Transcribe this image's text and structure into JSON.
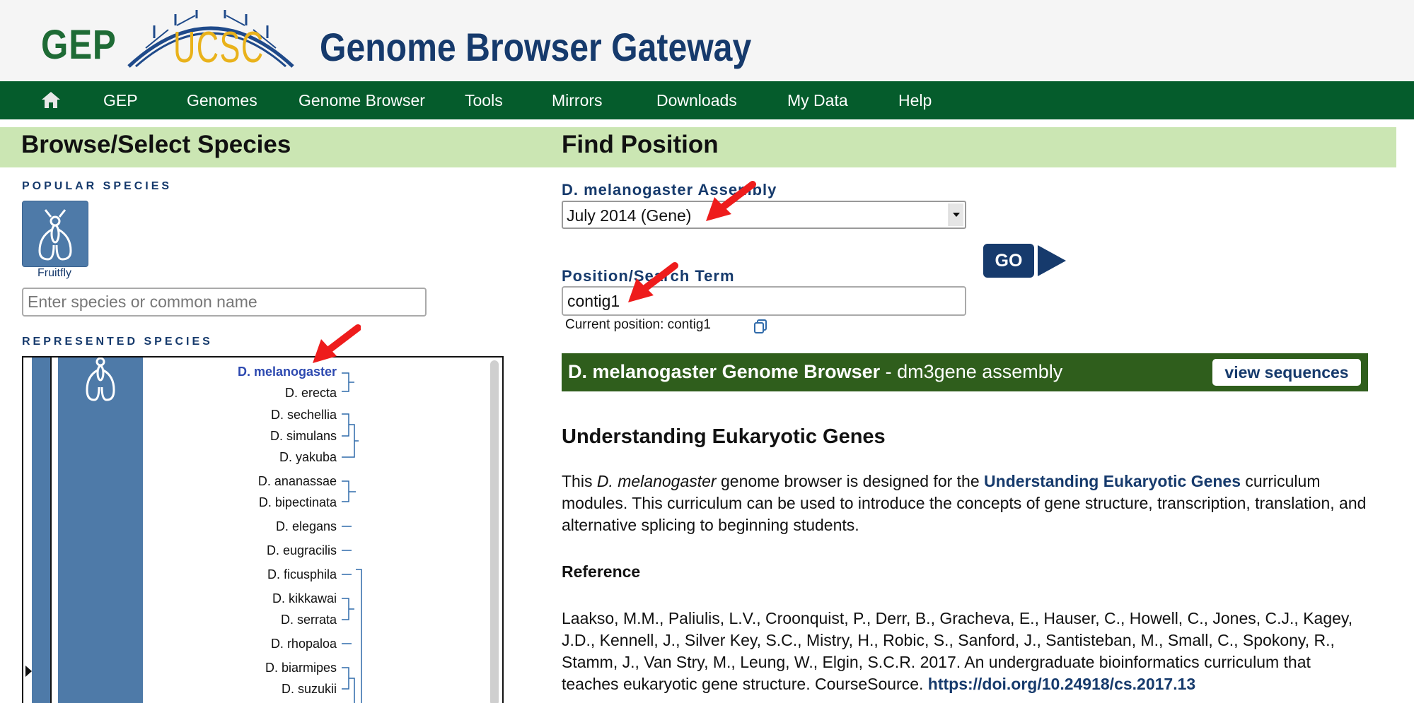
{
  "header": {
    "logo_gep": "GEP",
    "logo_ucsc": "UCSC",
    "title": "Genome Browser Gateway"
  },
  "nav": {
    "home_icon": "home-icon",
    "items": [
      "GEP",
      "Genomes",
      "Genome Browser",
      "Tools",
      "Mirrors",
      "Downloads",
      "My Data",
      "Help"
    ]
  },
  "browse": {
    "title": "Browse/Select Species",
    "popular_label": "POPULAR SPECIES",
    "popular_species": [
      {
        "label": "Fruitfly",
        "icon": "fly-icon"
      }
    ],
    "search_placeholder": "Enter species or common name",
    "represented_label": "REPRESENTED SPECIES",
    "species": [
      "D. melanogaster",
      "D. erecta",
      "D. sechellia",
      "D. simulans",
      "D. yakuba",
      "D. ananassae",
      "D. bipectinata",
      "D. elegans",
      "D. eugracilis",
      "D. ficusphila",
      "D. kikkawai",
      "D. serrata",
      "D. rhopaloa",
      "D. biarmipes",
      "D. suzukii"
    ],
    "selected_species": "D. melanogaster"
  },
  "find": {
    "title": "Find Position",
    "assembly_label": "D. melanogaster Assembly",
    "assembly_value": "July 2014 (Gene)",
    "position_label": "Position/Search Term",
    "position_value": "contig1",
    "current_position": "Current position: contig1",
    "go_label": "GO"
  },
  "browser_bar": {
    "title_bold": "D. melanogaster Genome Browser",
    "title_rest": " - dm3gene assembly",
    "view_sequences": "view sequences"
  },
  "info": {
    "heading": "Understanding Eukaryotic Genes",
    "p1_a": "This ",
    "p1_em": "D. melanogaster",
    "p1_b": " genome browser is designed for the ",
    "p1_link": "Understanding Eukaryotic Genes",
    "p1_c": " curriculum modules. This curriculum can be used to introduce the concepts of gene structure, transcription, translation, and alternative splicing to beginning students.",
    "reference_heading": "Reference",
    "reference_text": "Laakso, M.M., Paliulis, L.V., Croonquist, P., Derr, B., Gracheva, E., Hauser, C., Howell, C., Jones, C.J., Kagey, J.D., Kennell, J., Silver Key, S.C., Mistry, H., Robic, S., Sanford, J., Santisteban, M., Small, C., Spokony, R., Stamm, J., Van Stry, M., Leung, W., Elgin, S.C.R. 2017. An undergraduate bioinformatics curriculum that teaches eukaryotic gene structure. CourseSource. ",
    "reference_link": "https://doi.org/10.24918/cs.2017.13"
  },
  "colors": {
    "nav_green": "#055c2c",
    "section_green": "#cbe6b3",
    "navy": "#163a6c",
    "tile_blue": "#4e7aa8",
    "bar_green": "#2f5e1c",
    "annotation_red": "#ee1c1c"
  }
}
